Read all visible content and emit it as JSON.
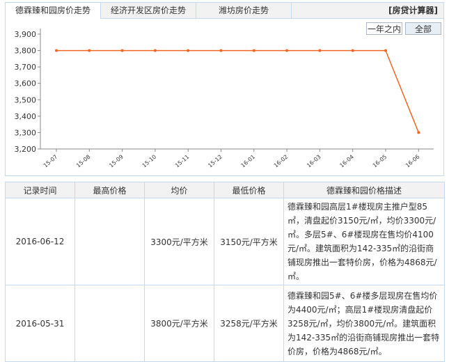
{
  "tabs": [
    {
      "label": "德霖臻和园房价走势",
      "active": true
    },
    {
      "label": "经济开发区房价走势",
      "active": false
    },
    {
      "label": "潍坊房价走势",
      "active": false
    }
  ],
  "calc_link": "[房贷计算器]",
  "range_buttons": [
    "一年之内",
    "全部"
  ],
  "chart_data": {
    "type": "line",
    "categories": [
      "15-07",
      "15-08",
      "15-09",
      "15-10",
      "15-11",
      "15-12",
      "16-01",
      "16-02",
      "16-03",
      "16-04",
      "16-05",
      "16-06"
    ],
    "values": [
      3800,
      3800,
      3800,
      3800,
      3800,
      3800,
      3800,
      3800,
      3800,
      3800,
      3800,
      3300
    ],
    "ylim": [
      3200,
      3900
    ],
    "yticks": [
      "3,200",
      "3,300",
      "3,400",
      "3,500",
      "3,600",
      "3,700",
      "3,800",
      "3,900"
    ],
    "grid": false,
    "line_color": "#f26522"
  },
  "table": {
    "headers": [
      "记录时间",
      "最高价格",
      "均价",
      "最低价格",
      "德霖臻和园价格描述"
    ],
    "rows": [
      {
        "date": "2016-06-12",
        "max": "",
        "avg": "3300元/平方米",
        "min": "3150元/平方米",
        "desc": "德霖臻和园高层1#楼现房主推户型85㎡，清盘起价3150元/㎡，均价3300元/㎡。多层5#、6#楼现房在售均价4100元/㎡。建筑面积为142-335㎡的沿街商铺现房推出一套特价房，价格为4868元/㎡。"
      },
      {
        "date": "2016-05-31",
        "max": "",
        "avg": "3800元/平方米",
        "min": "3258元/平方米",
        "desc": "德霖臻和园5#、6#楼多层现房在售均价为4400元/㎡；高层1#楼现房清盘起价3258元/㎡，均价3800元/㎡。建筑面积为142-335㎡的沿街商铺现房推出一套特价房，价格为4868元/㎡。"
      }
    ]
  }
}
